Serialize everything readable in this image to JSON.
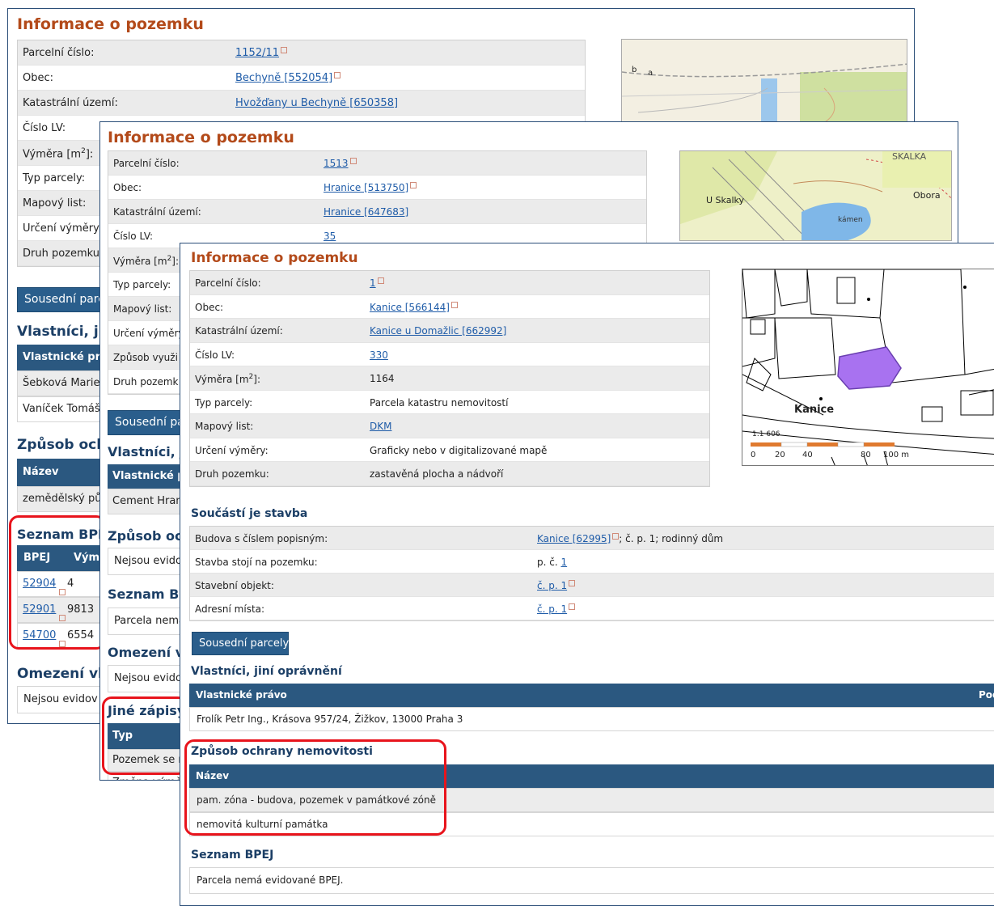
{
  "w1": {
    "title": "Informace o pozemku",
    "rows": [
      {
        "label": "Parcelní číslo:",
        "value": "1152/11"
      },
      {
        "label": "Obec:",
        "value": "Bechyně [552054]"
      },
      {
        "label": "Katastrální území:",
        "value": "Hvožďany u Bechyně [650358]"
      },
      {
        "label": "Číslo LV:",
        "value": ""
      },
      {
        "label": "Výměra [m",
        "value": ""
      },
      {
        "label": "Typ parcely:",
        "value": ""
      },
      {
        "label": "Mapový list:",
        "value": ""
      },
      {
        "label": "Určení výměry:",
        "value": ""
      },
      {
        "label": "Druh pozemku",
        "value": ""
      }
    ],
    "button": "Sousední parc",
    "owners_title": "Vlastníci, jiní",
    "owners_header": "Vlastnické prá",
    "owners": [
      "Šebková Marie",
      "Vaníček Tomáš"
    ],
    "protection_title": "Způsob ochr",
    "protection_header": "Název",
    "protection_rows": [
      "zemědělský pů"
    ],
    "bpej_title": "Seznam BPEJ",
    "bpej_headers": [
      "BPEJ",
      "Výmě"
    ],
    "bpej_rows": [
      {
        "code": "52904",
        "area": "4"
      },
      {
        "code": "52901",
        "area": "9813"
      },
      {
        "code": "54700",
        "area": "6554"
      }
    ],
    "limits_title": "Omezení vlas",
    "limits_text": "Nejsou evidov",
    "map_labels": [
      "b",
      "a"
    ]
  },
  "w2": {
    "title": "Informace o pozemku",
    "rows": [
      {
        "label": "Parcelní číslo:",
        "value": "1513"
      },
      {
        "label": "Obec:",
        "value": "Hranice [513750]"
      },
      {
        "label": "Katastrální území:",
        "value": "Hranice [647683]"
      },
      {
        "label": "Číslo LV:",
        "value": "35"
      },
      {
        "label": "Výměra [m",
        "value": ""
      },
      {
        "label": "Typ parcely:",
        "value": ""
      },
      {
        "label": "Mapový list:",
        "value": ""
      },
      {
        "label": "Určení výměry",
        "value": ""
      },
      {
        "label": "Způsob využi",
        "value": ""
      },
      {
        "label": "Druh pozemk",
        "value": ""
      }
    ],
    "button": "Sousední par",
    "owners_title": "Vlastníci, jin",
    "owners_header": "Vlastnické pr",
    "owners": [
      "Cement Hran"
    ],
    "protection_title": "Způsob och",
    "protection_text": "Nejsou evido",
    "bpej_title": "Seznam BPE",
    "bpej_text": "Parcela nemá",
    "limits_title": "Omezení vla",
    "limits_text": "Nejsou evido",
    "other_title": "Jiné zápisy",
    "other_header": "Typ",
    "other_rows": [
      "Pozemek se n",
      "Změna výměr"
    ],
    "map_labels": [
      "SKALKA",
      "U Skalky",
      "Obora",
      "kámen"
    ]
  },
  "w3": {
    "title": "Informace o pozemku",
    "rows": [
      {
        "label": "Parcelní číslo:",
        "value": "1",
        "link": true
      },
      {
        "label": "Obec:",
        "value": "Kanice [566144]",
        "link": true
      },
      {
        "label": "Katastrální území:",
        "value": "Kanice u Domažlic [662992]",
        "link": true
      },
      {
        "label": "Číslo LV:",
        "value": "330",
        "link": true
      },
      {
        "label": "Výměra [m",
        "value": "1164",
        "link": false
      },
      {
        "label": "Typ parcely:",
        "value": "Parcela katastru nemovitostí",
        "link": false
      },
      {
        "label": "Mapový list:",
        "value": "DKM",
        "link": true
      },
      {
        "label": "Určení výměry:",
        "value": "Graficky nebo v digitalizované mapě",
        "link": false
      },
      {
        "label": "Druh pozemku:",
        "value": "zastavěná plocha a nádvoří",
        "link": false
      }
    ],
    "sup2": "2",
    "label_close": "]:",
    "building_title": "Součástí je stavba",
    "building_rows": [
      {
        "label": "Budova s číslem popisným:",
        "link": "Kanice [62995]",
        "rest": "; č. p. 1; rodinný dům"
      },
      {
        "label": "Stavba stojí na pozemku:",
        "prefix": "p. č.",
        "link": "1",
        "rest": ""
      },
      {
        "label": "Stavební objekt:",
        "link": "č. p. 1",
        "rest": ""
      },
      {
        "label": "Adresní místa:",
        "link": "č. p. 1",
        "rest": ""
      }
    ],
    "button": "Sousední parcely",
    "owners_title": "Vlastníci, jiní oprávnění",
    "owners_header": "Vlastnické právo",
    "owners_header_right": "Podíl",
    "owners": [
      "Frolík Petr Ing., Krásova 957/24, Žižkov, 13000 Praha 3"
    ],
    "protection_title": "Způsob ochrany nemovitosti",
    "protection_header": "Název",
    "protection_rows": [
      "pam. zóna - budova, pozemek v památkové zóně",
      "nemovitá kulturní památka"
    ],
    "bpej_title": "Seznam BPEJ",
    "bpej_text": "Parcela nemá evidované BPEJ.",
    "map_labels": {
      "town": "Kanice",
      "scale": "1:1 606",
      "ticks": [
        "0",
        "20",
        "40",
        "80",
        "100 m"
      ]
    }
  },
  "colors": {
    "heading": "#b34a1a",
    "accent": "#2b5880",
    "link": "#1f5ca8",
    "highlight": "#e8141c",
    "parcel": "#a872f0"
  }
}
